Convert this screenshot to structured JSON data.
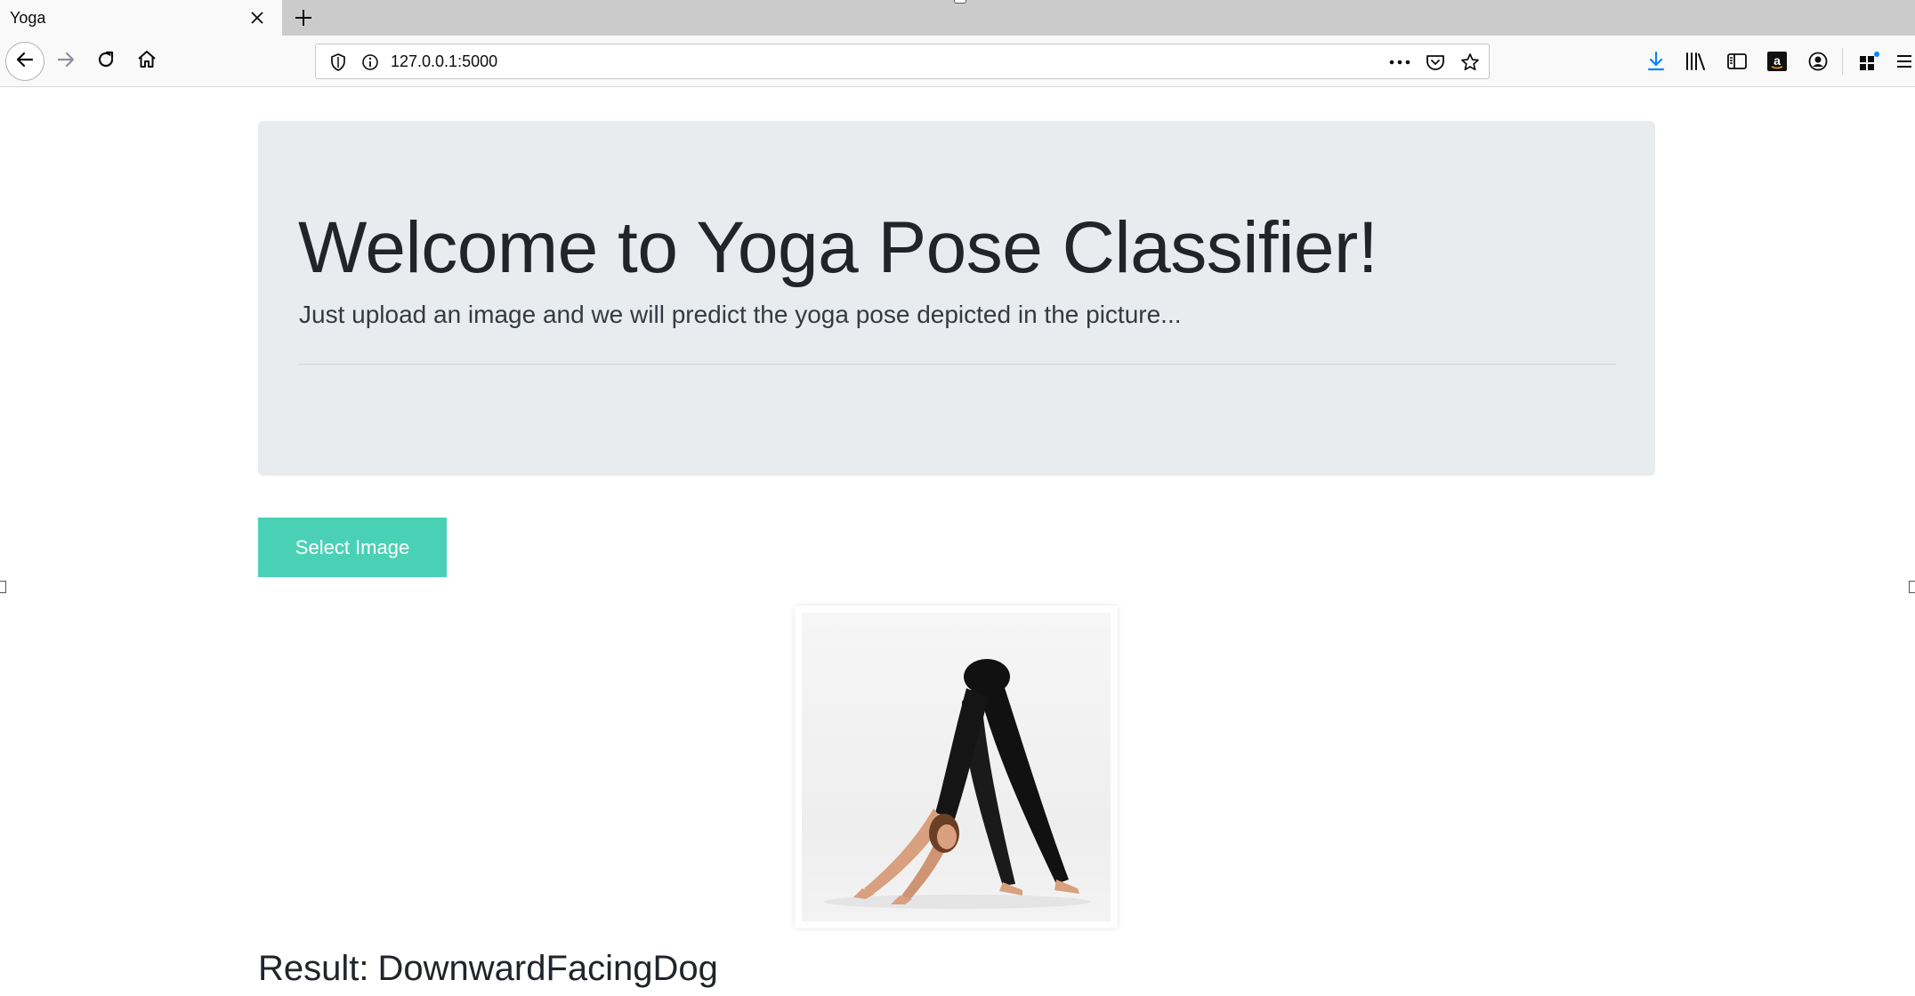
{
  "browser": {
    "tab_title": "Yoga",
    "url": "127.0.0.1:5000"
  },
  "page": {
    "heading": "Welcome to Yoga Pose Classifier!",
    "lead": "Just upload an image and we will predict the yoga pose depicted in the picture...",
    "select_button_label": "Select Image",
    "result_label": "Result:",
    "result_value": "DownwardFacingDog"
  },
  "colors": {
    "accent_button": "#4ad1b5",
    "jumbotron_bg": "#e9ecef",
    "download_icon": "#0a84ff"
  },
  "icons": [
    "close-icon",
    "plus-icon",
    "back-arrow-icon",
    "forward-arrow-icon",
    "reload-icon",
    "home-icon",
    "shield-icon",
    "info-icon",
    "more-dots-icon",
    "pocket-icon",
    "star-icon",
    "download-icon",
    "library-icon",
    "sidebar-icon",
    "amazon-icon",
    "account-icon",
    "extensions-icon",
    "menu-icon"
  ]
}
